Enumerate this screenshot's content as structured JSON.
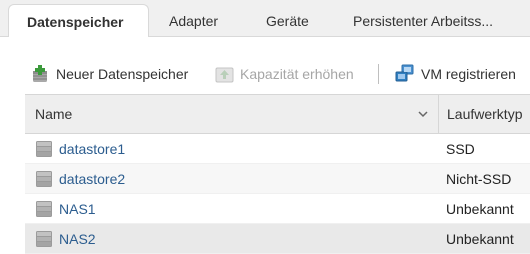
{
  "tabs": [
    {
      "label": "Datenspeicher",
      "active": true
    },
    {
      "label": "Adapter",
      "active": false
    },
    {
      "label": "Geräte",
      "active": false
    },
    {
      "label": "Persistenter Arbeitss...",
      "active": false
    }
  ],
  "toolbar": {
    "new_datastore": "Neuer Datenspeicher",
    "increase_capacity": "Kapazität erhöhen",
    "register_vm": "VM registrieren"
  },
  "table": {
    "columns": {
      "name": "Name",
      "type": "Laufwerktyp"
    },
    "rows": [
      {
        "name": "datastore1",
        "type": "SSD"
      },
      {
        "name": "datastore2",
        "type": "Nicht-SSD"
      },
      {
        "name": "NAS1",
        "type": "Unbekannt"
      },
      {
        "name": "NAS2",
        "type": "Unbekannt"
      }
    ]
  },
  "icons": {
    "new_datastore": "add-datastore-icon",
    "increase_capacity": "increase-capacity-icon",
    "register_vm": "register-vm-icon",
    "datastore": "datastore-icon",
    "sort": "chevron-down-icon"
  },
  "colors": {
    "link": "#2c5d8f",
    "disabled": "#a6a6a6",
    "header_bg": "#eeeeee",
    "add_green": "#3c9a3c",
    "vm_blue": "#2f7fc1"
  }
}
